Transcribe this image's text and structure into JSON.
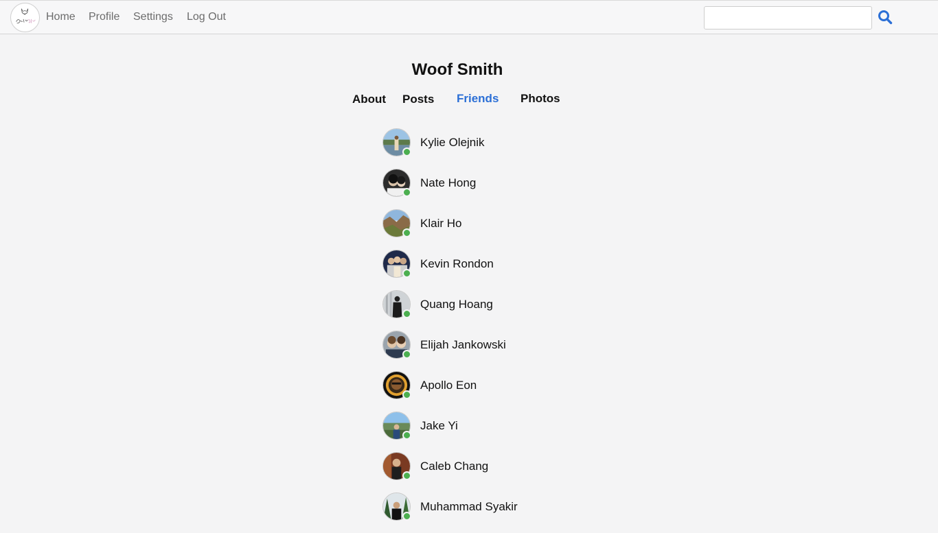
{
  "nav": {
    "logo_text": "OnlyPets",
    "home": "Home",
    "profile": "Profile",
    "settings": "Settings",
    "logout": "Log Out",
    "search_value": "",
    "search_icon": "search-icon",
    "accent_color": "#2b6fd6"
  },
  "profile": {
    "name": "Woof Smith"
  },
  "tabs": {
    "about": "About",
    "posts": "Posts",
    "friends": "Friends",
    "photos": "Photos",
    "active": "Friends"
  },
  "friends": [
    {
      "name": "Kylie Olejnik",
      "online": true
    },
    {
      "name": "Nate Hong",
      "online": true
    },
    {
      "name": "Klair Ho",
      "online": true
    },
    {
      "name": "Kevin Rondon",
      "online": true
    },
    {
      "name": "Quang Hoang",
      "online": true
    },
    {
      "name": "Elijah Jankowski",
      "online": true
    },
    {
      "name": "Apollo Eon",
      "online": true
    },
    {
      "name": "Jake Yi",
      "online": true
    },
    {
      "name": "Caleb Chang",
      "online": true
    },
    {
      "name": "Muhammad Syakir",
      "online": true
    }
  ],
  "status_colors": {
    "online": "#4caf50"
  }
}
